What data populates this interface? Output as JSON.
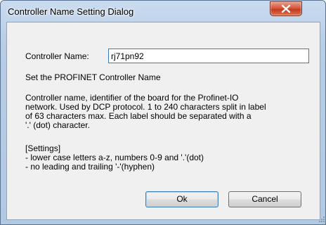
{
  "window": {
    "title": "Controller Name Setting Dialog",
    "close_glyph": "x-icon"
  },
  "form": {
    "controller_name_label": "Controller Name:",
    "controller_name_value": "rj71pn92",
    "subtitle": "Set the PROFINET Controller Name"
  },
  "description": {
    "lines": [
      "Controller name, identifier of the board for the Profinet-IO",
      "network. Used by DCP protocol. 1 to 240 characters split in label",
      "of 63 characters max. Each label should be separated with a",
      "'.' (dot) character."
    ]
  },
  "settings": {
    "header": "[Settings]",
    "rules": [
      "- lower case letters a-z, numbers 0-9 and '.'(dot)",
      "- no leading and trailing '-'(hyphen)"
    ]
  },
  "buttons": {
    "ok_label": "Ok",
    "cancel_label": "Cancel"
  },
  "colors": {
    "title_bar": "#b7cde6",
    "close_button": "#c94a2c",
    "input_border": "#3c7fb1",
    "dialog_background": "#f0f0f0"
  }
}
